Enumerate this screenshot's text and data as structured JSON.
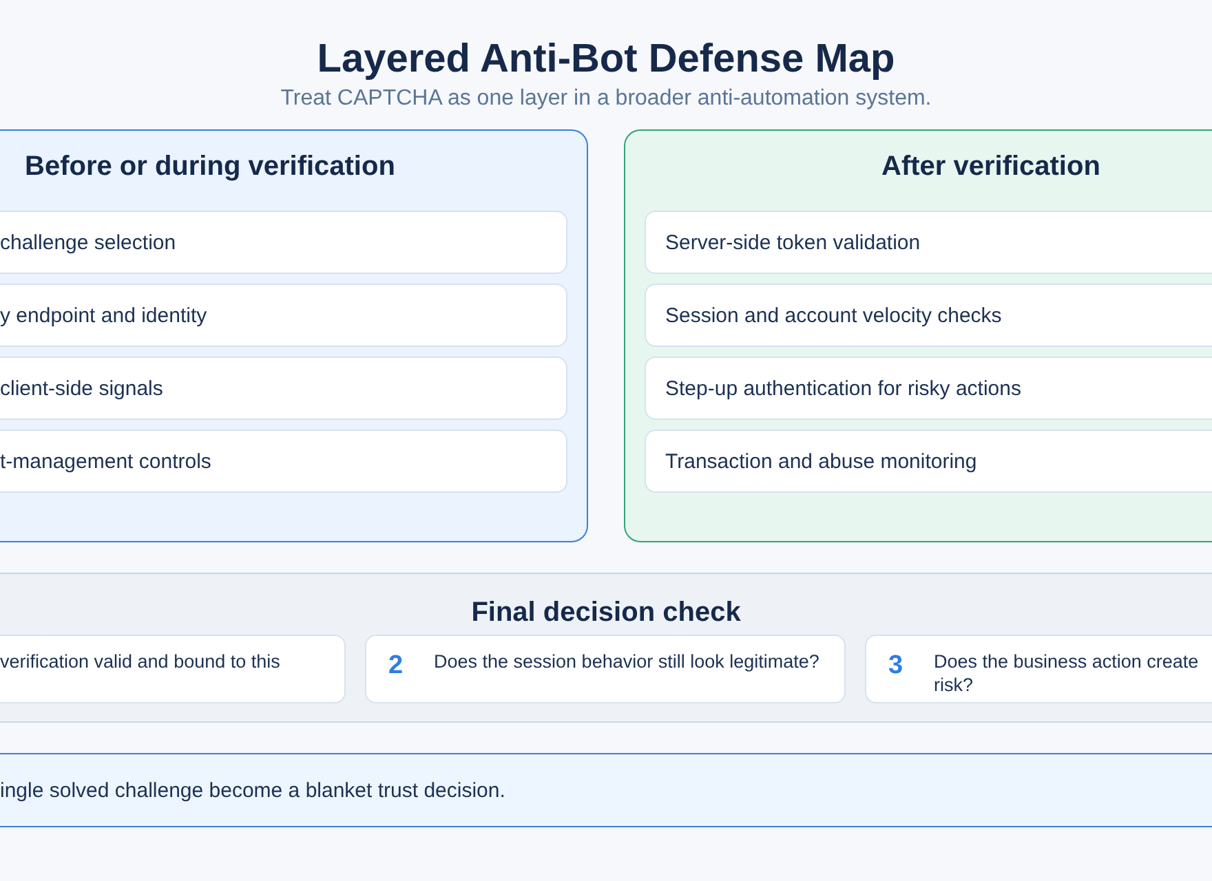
{
  "title": "Layered Anti-Bot Defense Map",
  "subtitle": "Treat CAPTCHA as one layer in a broader anti-automation system.",
  "columns": [
    {
      "kind": "before",
      "heading": "Before or during verification",
      "items": [
        "challenge selection",
        "y endpoint and identity",
        "client-side signals",
        "t-management controls"
      ]
    },
    {
      "kind": "after",
      "heading": "After verification",
      "items": [
        "Server-side token validation",
        "Session and account velocity checks",
        "Step-up authentication for risky actions",
        "Transaction and abuse monitoring"
      ]
    }
  ],
  "final_check": {
    "heading": "Final decision check",
    "questions": [
      {
        "text": "verification valid and bound to this"
      },
      {
        "number": "2",
        "text": "Does the session behavior still look legitimate?"
      },
      {
        "number": "3",
        "text": "Does the business action create risk?"
      }
    ]
  },
  "banner": {
    "text": "ingle solved challenge become a blanket trust decision."
  }
}
